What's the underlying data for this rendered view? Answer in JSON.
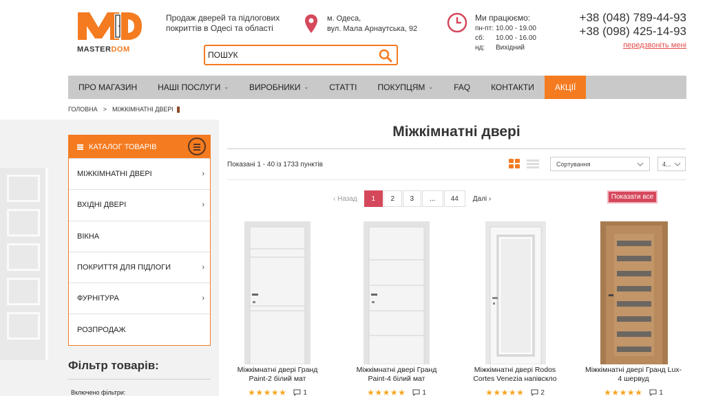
{
  "logo": {
    "brand_a": "MASTER",
    "brand_b": "DOM"
  },
  "header": {
    "tagline_1": "Продаж дверей та підлогових",
    "tagline_2": "покриттів в Одесі та області",
    "address_1": "м. Одеса,",
    "address_2": "вул. Мала Арнаутська, 92",
    "hours_title": "Ми працюємо:",
    "hours": [
      {
        "day": "пн-пт:",
        "time": "10.00 - 19.00"
      },
      {
        "day": "сб:",
        "time": "10.00 - 16.00"
      },
      {
        "day": "нд:",
        "time": "Вихідний"
      }
    ],
    "phone_1": "+38 (048) 789-44-93",
    "phone_2": "+38 (098) 425-14-93",
    "callback": "передзвоніть мені",
    "search_placeholder": "ПОШУК"
  },
  "nav": {
    "items": [
      {
        "label": "ПРО МАГАЗИН"
      },
      {
        "label": "НАШІ ПОСЛУГИ",
        "chev": "⌄"
      },
      {
        "label": "ВИРОБНИКИ",
        "chev": "⌄"
      },
      {
        "label": "СТАТТІ"
      },
      {
        "label": "ПОКУПЦЯМ",
        "chev": "⌄"
      },
      {
        "label": "FAQ"
      },
      {
        "label": "КОНТАКТИ"
      },
      {
        "label": "АКЦІЇ"
      }
    ]
  },
  "breadcrumb": {
    "home": "ГОЛОВНА",
    "sep": ">",
    "current": "МІЖКІМНАТНІ ДВЕРІ"
  },
  "catalog": {
    "title": "КАТАЛОГ ТОВАРІВ",
    "items": [
      {
        "label": "МІЖКІМНАТНІ ДВЕРІ",
        "arrow": "›"
      },
      {
        "label": "ВХІДНІ ДВЕРІ",
        "arrow": "›"
      },
      {
        "label": "ВІКНА",
        "arrow": ""
      },
      {
        "label": "ПОКРИТТЯ ДЛЯ ПІДЛОГИ",
        "arrow": "›"
      },
      {
        "label": "ФУРНІТУРА",
        "arrow": "›"
      },
      {
        "label": "РОЗПРОДАЖ",
        "arrow": ""
      }
    ]
  },
  "filter": {
    "title": "Фільтр товарів:",
    "applied": "Включено фільтри:"
  },
  "main": {
    "title": "Міжкімнатні двері",
    "shown": "Показані 1 - 40 із 1733 пунктів",
    "sort_label": "Сортування",
    "per_page": "4...",
    "prev": "Назад",
    "next": "Далі",
    "pages": [
      "1",
      "2",
      "3",
      "...",
      "44"
    ],
    "show_all": "Показати все"
  },
  "products": [
    {
      "title_1": "Міжкімнатні двері Гранд",
      "title_2": "Paint-2 білий мат",
      "stars": "★★★★★",
      "comments": "1",
      "style": "paint2"
    },
    {
      "title_1": "Міжкімнатні двері Гранд",
      "title_2": "Paint-4 білий мат",
      "stars": "★★★★★",
      "comments": "1",
      "style": "paint4"
    },
    {
      "title_1": "Міжкімнатні двері Rodos",
      "title_2": "Cortes Venezia напівскло",
      "stars": "★★★★★",
      "comments": "2",
      "style": "glass"
    },
    {
      "title_1": "Міжкімнатні двері Гранд Lux-",
      "title_2": "4 шервуд",
      "stars": "★★★★★",
      "comments": "1",
      "style": "wood"
    }
  ],
  "colors": {
    "accent": "#f47b20",
    "active_page": "#d5485c",
    "nav_bg": "#c9c9c9",
    "stars": "#f5a623"
  }
}
